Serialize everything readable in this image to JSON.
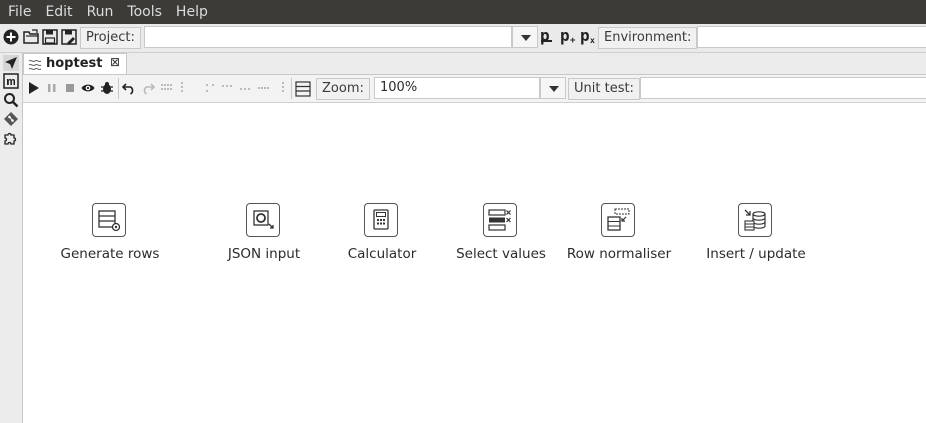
{
  "menubar": {
    "items": [
      "File",
      "Edit",
      "Run",
      "Tools",
      "Help"
    ]
  },
  "toolbar": {
    "project_label": "Project:",
    "project_value": "",
    "environment_label": "Environment:",
    "environment_value": "",
    "p_icons": [
      "p",
      "p",
      "p"
    ]
  },
  "tab": {
    "label": "hoptest",
    "close": "⊠"
  },
  "pipeline_toolbar": {
    "zoom_label": "Zoom:",
    "zoom_value": "100%",
    "unit_test_label": "Unit test:",
    "unit_test_value": ""
  },
  "transforms": [
    {
      "name": "Generate rows",
      "icon": "generate-rows-icon"
    },
    {
      "name": "JSON input",
      "icon": "json-input-icon"
    },
    {
      "name": "Calculator",
      "icon": "calculator-icon"
    },
    {
      "name": "Select values",
      "icon": "select-values-icon"
    },
    {
      "name": "Row normaliser",
      "icon": "row-normaliser-icon"
    },
    {
      "name": "Insert / update",
      "icon": "insert-update-icon"
    }
  ],
  "colors": {
    "menubar_bg": "#3c3b37",
    "toolbar_bg": "#eaeaea",
    "accent": "#333333"
  }
}
